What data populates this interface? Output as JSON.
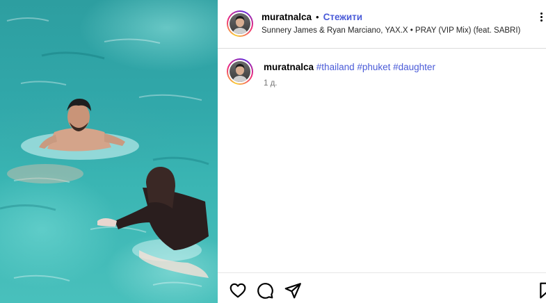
{
  "post": {
    "username": "muratnalca",
    "separator": "•",
    "follow_label": "Стежити",
    "audio": "Sunnery James & Ryan Marciano, YAX.X • PRAY (VIP Mix) (feat. SABRI)"
  },
  "caption": {
    "username": "muratnalca",
    "hashtags": "#thailand #phuket #daughter",
    "time": "1 д."
  },
  "actions": [
    "heart-icon",
    "comment-icon",
    "share-icon",
    "bookmark-icon"
  ],
  "colors": {
    "link": "#4a5bd8",
    "water": "#31a8aa",
    "border": "#dbdbdb"
  }
}
